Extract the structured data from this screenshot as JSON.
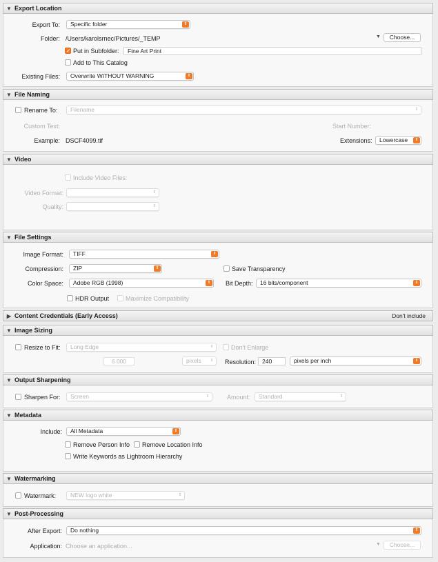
{
  "sections": {
    "export_location": {
      "title": "Export Location",
      "export_to_label": "Export To:",
      "export_to_value": "Specific folder",
      "folder_label": "Folder:",
      "folder_path": "/Users/karolsrnec/Pictures/_TEMP",
      "choose_label": "Choose...",
      "subfolder_label": "Put in Subfolder:",
      "subfolder_checked": true,
      "subfolder_value": "Fine Art Print",
      "add_catalog_label": "Add to This Catalog",
      "existing_label": "Existing Files:",
      "existing_value": "Overwrite WITHOUT WARNING"
    },
    "file_naming": {
      "title": "File Naming",
      "rename_label": "Rename To:",
      "rename_value": "Filename",
      "custom_text_label": "Custom Text:",
      "start_number_label": "Start Number:",
      "example_label": "Example:",
      "example_value": "DSCF4099.tif",
      "extensions_label": "Extensions:",
      "extensions_value": "Lowercase"
    },
    "video": {
      "title": "Video",
      "include_label": "Include Video Files:",
      "format_label": "Video Format:",
      "quality_label": "Quality:"
    },
    "file_settings": {
      "title": "File Settings",
      "format_label": "Image Format:",
      "format_value": "TIFF",
      "compression_label": "Compression:",
      "compression_value": "ZIP",
      "transparency_label": "Save Transparency",
      "color_space_label": "Color Space:",
      "color_space_value": "Adobe RGB (1998)",
      "bit_depth_label": "Bit Depth:",
      "bit_depth_value": "16 bits/component",
      "hdr_label": "HDR Output",
      "max_compat_label": "Maximize Compatibility"
    },
    "content_credentials": {
      "title": "Content Credentials (Early Access)",
      "status": "Don't include"
    },
    "image_sizing": {
      "title": "Image Sizing",
      "resize_label": "Resize to Fit:",
      "resize_value": "Long Edge",
      "dont_enlarge_label": "Don't Enlarge",
      "size_value": "6 000",
      "units_value": "pixels",
      "resolution_label": "Resolution:",
      "resolution_value": "240",
      "resolution_units": "pixels per inch"
    },
    "output_sharpening": {
      "title": "Output Sharpening",
      "sharpen_label": "Sharpen For:",
      "sharpen_value": "Screen",
      "amount_label": "Amount:",
      "amount_value": "Standard"
    },
    "metadata": {
      "title": "Metadata",
      "include_label": "Include:",
      "include_value": "All Metadata",
      "remove_person_label": "Remove Person Info",
      "remove_location_label": "Remove Location Info",
      "keywords_label": "Write Keywords as Lightroom Hierarchy"
    },
    "watermarking": {
      "title": "Watermarking",
      "watermark_label": "Watermark:",
      "watermark_value": "NEW logo white"
    },
    "post_processing": {
      "title": "Post-Processing",
      "after_export_label": "After Export:",
      "after_export_value": "Do nothing",
      "application_label": "Application:",
      "application_placeholder": "Choose an application...",
      "choose_label": "Choose..."
    }
  },
  "colors": {
    "accent": "#f07a28",
    "header_bg": "#e6e6e6",
    "panel_bg": "#f8f8f8"
  }
}
